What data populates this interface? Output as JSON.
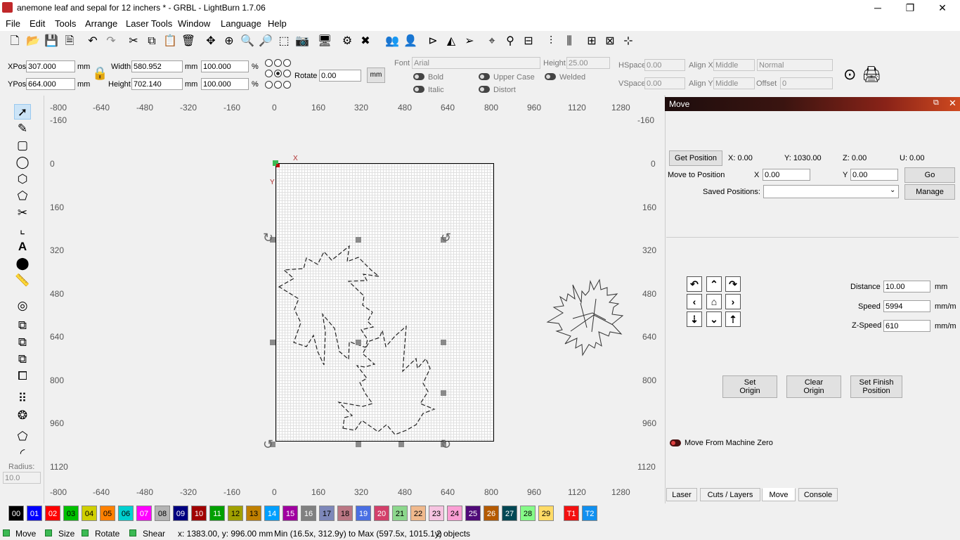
{
  "window": {
    "title": "anemone leaf and sepal for 12 inchers * - GRBL - LightBurn 1.7.06",
    "minimize": "─",
    "restore": "❐",
    "close": "✕"
  },
  "menu": [
    "File",
    "Edit",
    "Tools",
    "Arrange",
    "Laser Tools",
    "Window",
    "Language",
    "Help"
  ],
  "props": {
    "xpos_label": "XPos",
    "xpos": "307.000",
    "ypos_label": "YPos",
    "ypos": "664.000",
    "unit_mm": "mm",
    "width_label": "Width",
    "width": "580.952",
    "height_label": "Height",
    "height": "702.140",
    "scale_w": "100.000",
    "scale_h": "100.000",
    "percent": "%",
    "rotate_label": "Rotate",
    "rotate": "0.00",
    "mm_button": "mm",
    "font_label": "Font",
    "font": "Arial",
    "fheight_label": "Height",
    "fheight": "25.00",
    "bold": "Bold",
    "italic": "Italic",
    "upper_case": "Upper Case",
    "distort": "Distort",
    "welded": "Welded",
    "hspace_label": "HSpace",
    "hspace": "0.00",
    "vspace_label": "VSpace",
    "vspace": "0.00",
    "alignx_label": "Align X",
    "alignx": "Middle",
    "aligny_label": "Align Y",
    "aligny": "Middle",
    "normal": "Normal",
    "offset_label": "Offset",
    "offset": "0"
  },
  "left": {
    "radius_label": "Radius:",
    "radius": "10.0"
  },
  "ruler": {
    "top": [
      "-800",
      "-640",
      "-480",
      "-320",
      "-160",
      "0",
      "160",
      "320",
      "480",
      "640",
      "800",
      "960",
      "1120",
      "1280"
    ],
    "left": [
      "-160",
      "0",
      "160",
      "320",
      "480",
      "640",
      "800",
      "960",
      "1120"
    ],
    "right": [
      "-160",
      "0",
      "160",
      "320",
      "480",
      "640",
      "800",
      "960",
      "1120"
    ],
    "axis_x": "X",
    "axis_y": "Y"
  },
  "move": {
    "panel_title": "Move",
    "get_position": "Get Position",
    "x_read": "X: 0.00",
    "y_read": "Y: 1030.00",
    "z_read": "Z: 0.00",
    "u_read": "U: 0.00",
    "move_to_position": "Move to Position",
    "x_label": "X",
    "x": "0.00",
    "y_label": "Y",
    "y": "0.00",
    "go": "Go",
    "saved_positions": "Saved Positions:",
    "saved_value": "",
    "manage": "Manage",
    "distance_label": "Distance",
    "distance": "10.00",
    "distance_unit": "mm",
    "speed_label": "Speed",
    "speed": "5994",
    "speed_unit": "mm/m",
    "zspeed_label": "Z-Speed",
    "zspeed": "610",
    "zspeed_unit": "mm/m",
    "set_origin": [
      "Set",
      "Origin"
    ],
    "clear_origin": [
      "Clear",
      "Origin"
    ],
    "set_finish": [
      "Set Finish",
      "Position"
    ],
    "move_from_zero": "Move From Machine Zero"
  },
  "tabs": [
    "Laser",
    "Cuts / Layers",
    "Move",
    "Console"
  ],
  "active_tab": "Move",
  "palette": [
    {
      "l": "00",
      "c": "#000000",
      "t": "#fff"
    },
    {
      "l": "01",
      "c": "#0000ff",
      "t": "#fff"
    },
    {
      "l": "02",
      "c": "#ff0000",
      "t": "#fff"
    },
    {
      "l": "03",
      "c": "#00c000",
      "t": "#000"
    },
    {
      "l": "04",
      "c": "#d0d000",
      "t": "#000"
    },
    {
      "l": "05",
      "c": "#ff8000",
      "t": "#000"
    },
    {
      "l": "06",
      "c": "#00d0d0",
      "t": "#000"
    },
    {
      "l": "07",
      "c": "#ff00ff",
      "t": "#fff"
    },
    {
      "l": "08",
      "c": "#b4b4b4",
      "t": "#000"
    },
    {
      "l": "09",
      "c": "#000080",
      "t": "#fff"
    },
    {
      "l": "10",
      "c": "#a00000",
      "t": "#fff"
    },
    {
      "l": "11",
      "c": "#00a000",
      "t": "#fff"
    },
    {
      "l": "12",
      "c": "#a0a000",
      "t": "#000"
    },
    {
      "l": "13",
      "c": "#c08000",
      "t": "#000"
    },
    {
      "l": "14",
      "c": "#00a0ff",
      "t": "#fff"
    },
    {
      "l": "15",
      "c": "#a000a0",
      "t": "#fff"
    },
    {
      "l": "16",
      "c": "#808080",
      "t": "#fff"
    },
    {
      "l": "17",
      "c": "#7d87b9",
      "t": "#000"
    },
    {
      "l": "18",
      "c": "#bb7784",
      "t": "#000"
    },
    {
      "l": "19",
      "c": "#4a6fe3",
      "t": "#fff"
    },
    {
      "l": "20",
      "c": "#d33f6a",
      "t": "#fff"
    },
    {
      "l": "21",
      "c": "#8cd78c",
      "t": "#000"
    },
    {
      "l": "22",
      "c": "#f0b98d",
      "t": "#000"
    },
    {
      "l": "23",
      "c": "#f6c4e1",
      "t": "#000"
    },
    {
      "l": "24",
      "c": "#fa9ed4",
      "t": "#000"
    },
    {
      "l": "25",
      "c": "#500a78",
      "t": "#fff"
    },
    {
      "l": "26",
      "c": "#b45a00",
      "t": "#fff"
    },
    {
      "l": "27",
      "c": "#004754",
      "t": "#fff"
    },
    {
      "l": "28",
      "c": "#86fa88",
      "t": "#000"
    },
    {
      "l": "29",
      "c": "#ffdb66",
      "t": "#000"
    },
    {
      "l": "T1",
      "c": "#f31010",
      "t": "#fff"
    },
    {
      "l": "T2",
      "c": "#1090f0",
      "t": "#fff"
    }
  ],
  "status": {
    "move": "Move",
    "size": "Size",
    "rotate": "Rotate",
    "shear": "Shear",
    "coords": "x: 1383.00, y: 996.00 mm",
    "range": "Min (16.5x, 312.9y) to Max (597.5x, 1015.1y)",
    "objects": "2 objects"
  },
  "icons": {
    "toolbar": [
      "new-file-icon",
      "open-icon",
      "save-icon",
      "export-icon",
      "undo-icon",
      "redo-icon",
      "cut-icon",
      "copy-icon",
      "paste-icon",
      "delete-icon",
      "move-icon",
      "zoom-frame-icon",
      "zoom-in-icon",
      "zoom-out-icon",
      "select-frame-icon",
      "camera-icon",
      "monitor-icon",
      "settings-icon",
      "tools-icon",
      "users-icon",
      "user-icon",
      "mirror-h-icon",
      "mirror-v-icon",
      "send-icon",
      "target-icon",
      "machine-icon",
      "group-icon",
      "align-icon",
      "distribute-icon",
      "spacing-icon",
      "origin-icon"
    ],
    "left": [
      "select-icon",
      "pencil-icon",
      "rectangle-icon",
      "ellipse-icon",
      "hexagon-icon",
      "polygon-icon",
      "trim-icon",
      "measure-icon",
      "text-icon",
      "position-icon",
      "ruler-icon",
      "offset-icon",
      "boolean-union-icon",
      "boolean-subtract-icon",
      "boolean-intersect-icon",
      "weld-icon",
      "grid-array-icon",
      "circular-array-icon",
      "node-edit-icon",
      "corner-icon"
    ]
  }
}
